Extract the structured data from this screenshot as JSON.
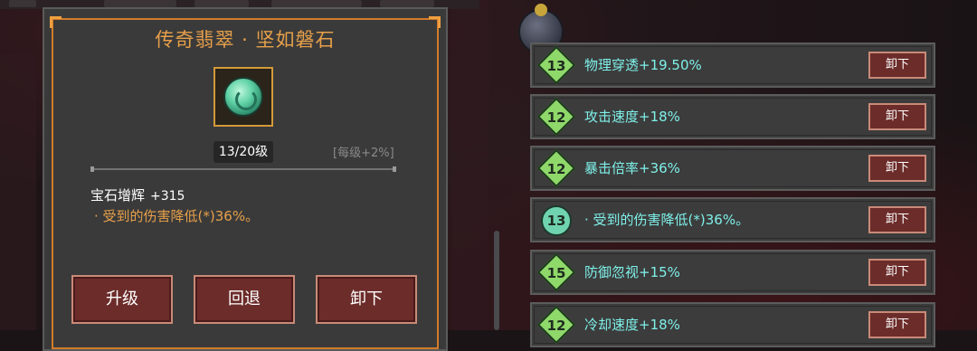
{
  "gem_panel": {
    "title": "传奇翡翠 · 坚如磐石",
    "level": "13/20级",
    "per_level": "[每级+2%]",
    "stat_label": "宝石增辉",
    "stat_value": "+315",
    "effect": "· 受到的伤害降低(*)36%。",
    "buttons": {
      "upgrade": "升级",
      "revert": "回退",
      "unequip": "卸下"
    }
  },
  "equipped_list": {
    "rows": [
      {
        "badge": "13",
        "badge_color": "#8fd86a",
        "text": "物理穿透+19.50%",
        "button": "卸下"
      },
      {
        "badge": "12",
        "badge_color": "#8fd86a",
        "text": "攻击速度+18%",
        "button": "卸下"
      },
      {
        "badge": "12",
        "badge_color": "#8fd86a",
        "text": "暴击倍率+36%",
        "button": "卸下"
      },
      {
        "badge": "13",
        "badge_color": "#6fd3b0",
        "text": "· 受到的伤害降低(*)36%。",
        "button": "卸下"
      },
      {
        "badge": "15",
        "badge_color": "#8fd86a",
        "text": "防御忽视+15%",
        "button": "卸下"
      },
      {
        "badge": "12",
        "badge_color": "#8fd86a",
        "text": "冷却速度+18%",
        "button": "卸下"
      }
    ]
  }
}
